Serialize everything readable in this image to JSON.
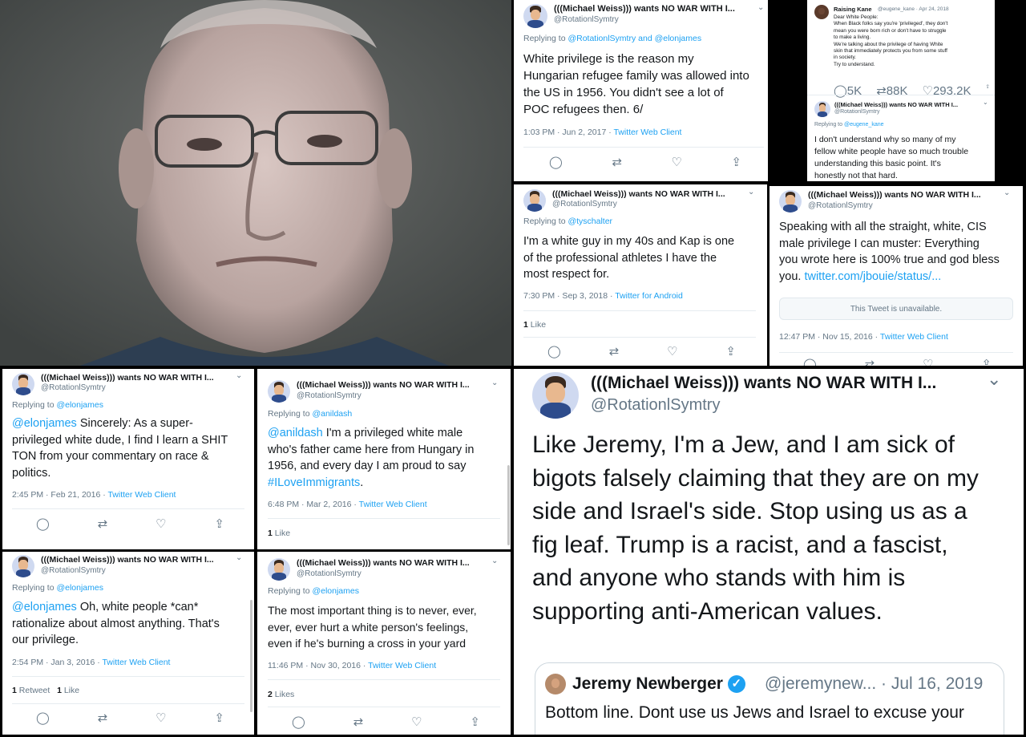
{
  "colors": {
    "link": "#1da1f2",
    "muted": "#657786",
    "text": "#14171a",
    "verified": "#1da1f2"
  },
  "icons": {
    "reply": "reply-icon",
    "retweet": "retweet-icon",
    "like": "like-icon",
    "share": "share-icon",
    "chevron": "chevron-down-icon",
    "verified": "verified-check-icon"
  },
  "author": {
    "name": "(((Michael Weiss))) wants NO WAR WITH I...",
    "handle": "@RotationlSymtry"
  },
  "tweet_refugee": {
    "replying_label": "Replying to",
    "replying_to": "@RotationlSymtry and @elonjames",
    "lines": [
      "White privilege is the reason my",
      "Hungarian refugee family was allowed into",
      "the US in 1956. You didn't see a lot of",
      "POC refugees then. 6/"
    ],
    "meta_time": "1:03 PM · Jun 2, 2017 · ",
    "meta_client": "Twitter Web Client"
  },
  "tweet_kane": {
    "name": "Raising Kane",
    "handle_date": "@eugene_kane · Apr 24, 2018",
    "lines": [
      "Dear White People:",
      "When Black folks say you're 'privileged', they don't",
      "mean you were born rich or don't have to struggle",
      "to make a living.",
      "We're talking about the privilege of having White",
      "skin that immediately protects you from some stuff",
      "in society.",
      "Try to understand."
    ],
    "counts": {
      "replies": "5K",
      "retweets": "88K",
      "likes": "293.2K"
    },
    "reply_name": "(((Michael Weiss))) wants NO WAR WITH I...",
    "reply_handle": "@RotationlSymtry",
    "replying_label": "Replying to",
    "replying_to": "@eugene_kane",
    "reply_lines": [
      "I don't understand why so many of my",
      "fellow white people have so much trouble",
      "understanding this basic point.  It's",
      "honestly not that hard."
    ]
  },
  "tweet_kap": {
    "replying_label": "Replying to",
    "replying_to": "@tyschalter",
    "lines": [
      "I'm a white guy in my 40s and Kap is one",
      "of the professional athletes I have the",
      "most respect for."
    ],
    "meta_time": "7:30 PM · Sep 3, 2018 · ",
    "meta_client": "Twitter for Android",
    "likes_count": "1",
    "likes_label": "Like"
  },
  "tweet_cis": {
    "lines": [
      "Speaking with all the straight, white, CIS",
      "male privilege I can muster:  Everything",
      "you wrote here is 100% true and god bless"
    ],
    "last_line_prefix": "you. ",
    "link": "twitter.com/jbouie/status/...",
    "unavailable": "This Tweet is unavailable.",
    "meta_time": "12:47 PM · Nov 15, 2016 · ",
    "meta_client": "Twitter Web Client"
  },
  "tweet_shit": {
    "replying_label": "Replying to",
    "replying_to": "@elonjames",
    "mention": "@elonjames",
    "line1_rest": " Sincerely: As a super-",
    "lines": [
      "privileged white dude, I find I learn a SHIT",
      "TON from your commentary on race &",
      "politics."
    ],
    "meta_time": "2:45 PM · Feb 21, 2016 · ",
    "meta_client": "Twitter Web Client"
  },
  "tweet_hungary": {
    "replying_label": "Replying to",
    "replying_to": "@anildash",
    "mention": "@anildash",
    "line1_rest": "  I'm a privileged white male",
    "lines": [
      "who's father came here from Hungary in",
      "1956, and every day I am proud to say"
    ],
    "hashtag": "#ILoveImmigrants",
    "hashtag_end": ".",
    "meta_time": "6:48 PM · Mar 2, 2016 · ",
    "meta_client": "Twitter Web Client",
    "likes_count": "1",
    "likes_label": "Like"
  },
  "tweet_rationalize": {
    "replying_label": "Replying to",
    "replying_to": "@elonjames",
    "mention": "@elonjames",
    "line1_rest": " Oh, white people *can*",
    "lines": [
      "rationalize about almost anything. That's",
      "our privilege."
    ],
    "meta_time": "2:54 PM · Jan 3, 2016 · ",
    "meta_client": "Twitter Web Client",
    "retweets_count": "1",
    "retweets_label": "Retweet",
    "likes_count": "1",
    "likes_label": "Like"
  },
  "tweet_cross": {
    "replying_label": "Replying to",
    "replying_to": "@elonjames",
    "lines": [
      "The most important thing is to never, ever,",
      "ever, ever hurt a white person's feelings,",
      "even if he's burning a cross in your yard"
    ],
    "meta_time": "11:46 PM · Nov 30, 2016 · ",
    "meta_client": "Twitter Web Client",
    "likes_count": "2",
    "likes_label": "Likes"
  },
  "tweet_jeremy": {
    "lines": [
      "Like Jeremy, I'm a Jew, and I am sick of",
      "bigots falsely claiming that they are on my",
      "side and Israel's side.  Stop using us as a",
      "fig leaf.  Trump is a racist, and a fascist,",
      "and anyone who stands with him is",
      "supporting anti-American values."
    ],
    "quote_name": "Jeremy Newberger",
    "quote_handle": "@jeremynew...",
    "quote_date": "· Jul 16, 2019",
    "quote_text": "Bottom line. Dont use us Jews and Israel to excuse your"
  }
}
